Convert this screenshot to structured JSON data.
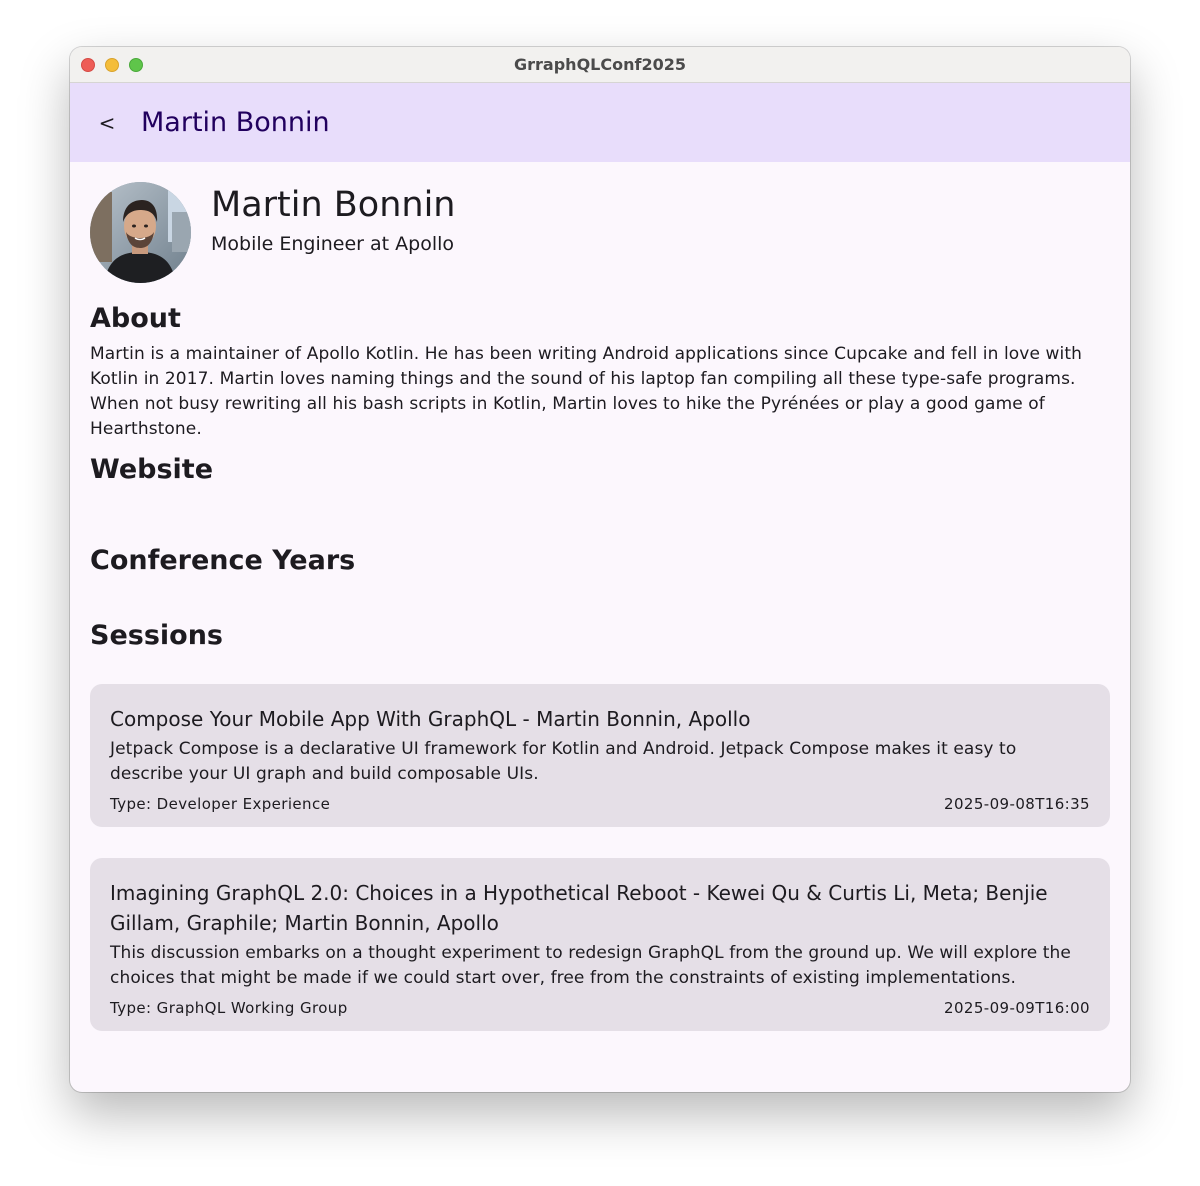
{
  "window": {
    "title": "GrraphQLConf2025"
  },
  "appbar": {
    "back_label": "<",
    "title": "Martin Bonnin"
  },
  "profile": {
    "name": "Martin Bonnin",
    "role": "Mobile Engineer at Apollo",
    "avatar_icon": "speaker-photo"
  },
  "about": {
    "heading": "About",
    "text": "Martin is a maintainer of Apollo Kotlin. He has been writing Android applications since Cupcake and fell in love with Kotlin in 2017. Martin loves naming things and the sound of his laptop fan compiling all these type-safe programs. When not busy rewriting all his bash scripts in Kotlin, Martin loves to hike the Pyrénées or play a good game of Hearthstone."
  },
  "website": {
    "heading": "Website"
  },
  "conference_years": {
    "heading": "Conference Years"
  },
  "sessions": {
    "heading": "Sessions",
    "items": [
      {
        "title": "Compose Your Mobile App With GraphQL - Martin Bonnin, Apollo",
        "description": "Jetpack Compose is a declarative UI framework for Kotlin and Android. Jetpack Compose makes it easy to describe your UI graph and build composable UIs.",
        "type": "Type: Developer Experience",
        "time": "2025-09-08T16:35"
      },
      {
        "title": "Imagining GraphQL 2.0: Choices in a Hypothetical Reboot - Kewei Qu & Curtis Li, Meta; Benjie Gillam, Graphile; Martin Bonnin, Apollo",
        "description": "This discussion embarks on a thought experiment to redesign GraphQL from the ground up. We will explore the choices that might be made if we could start over, free from the constraints of existing implementations.",
        "type": "Type: GraphQL Working Group",
        "time": "2025-09-09T16:00"
      }
    ]
  },
  "colors": {
    "appbar_bg": "#e8ddfb",
    "appbar_title": "#21005e",
    "page_bg": "#fcf7fd",
    "card_bg": "#e5dfe7"
  }
}
